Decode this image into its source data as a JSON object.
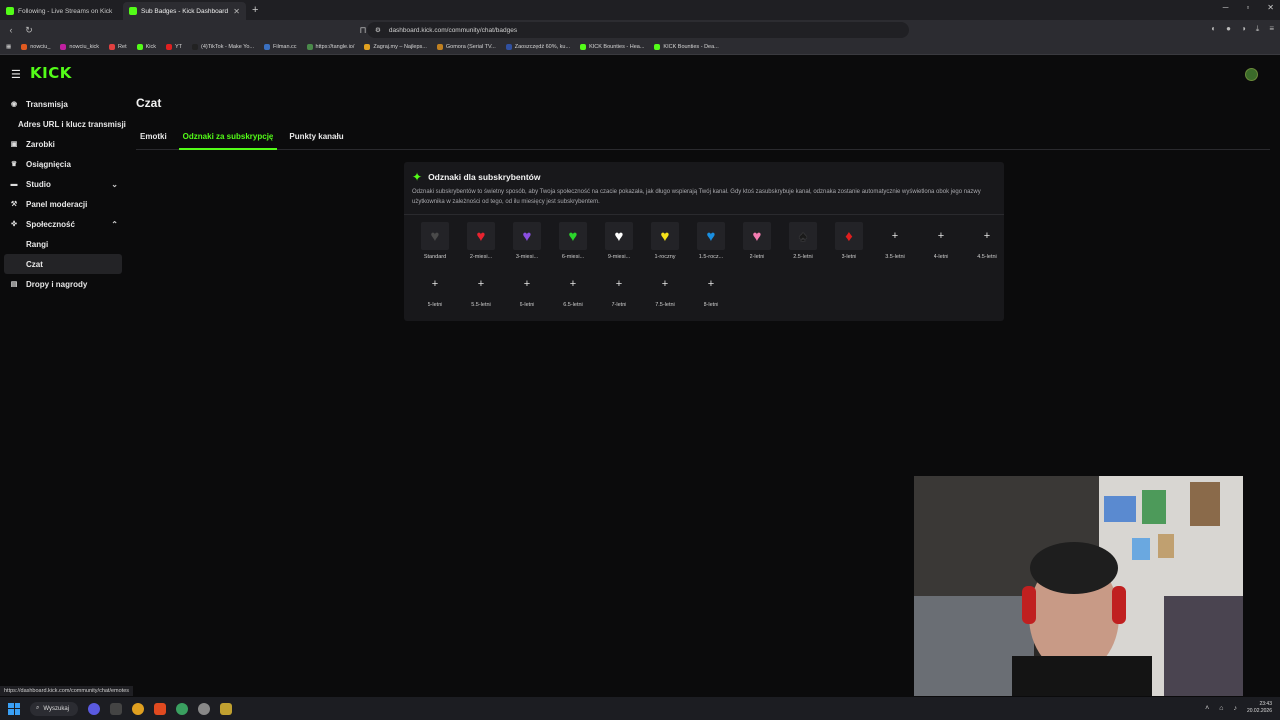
{
  "browser": {
    "tabs": [
      {
        "title": "Following - Live Streams on Kick",
        "active": false
      },
      {
        "title": "Sub Badges - Kick Dashboard",
        "active": true
      }
    ],
    "url": "dashboard.kick.com/community/chat/badges",
    "bookmarks": [
      "nowciu_",
      "nowciu_kick",
      "Ret",
      "Kick",
      "YT",
      "(4)TikTok - Make Yo...",
      "Filman.cc",
      "https://tangle.io/",
      "Zagraj.my – Najleps...",
      "Gomora (Serial TV...",
      "Zaoszczędź 60%, ku...",
      "KICK Bounties - Hea...",
      "KICK Bounties - Dea..."
    ]
  },
  "app": {
    "logo": "KICK",
    "sidebar": [
      {
        "label": "Transmisja",
        "icon": "broadcast-icon",
        "type": "main"
      },
      {
        "label": "Adres URL i klucz transmisji",
        "icon": "",
        "type": "indent"
      },
      {
        "label": "Zarobki",
        "icon": "money-icon",
        "type": "main"
      },
      {
        "label": "Osiągnięcia",
        "icon": "trophy-icon",
        "type": "main"
      },
      {
        "label": "Studio",
        "icon": "studio-icon",
        "type": "main",
        "chevron": "⌄"
      },
      {
        "label": "Panel moderacji",
        "icon": "wrench-icon",
        "type": "main"
      },
      {
        "label": "Społeczność",
        "icon": "community-icon",
        "type": "main",
        "chevron": "⌃"
      },
      {
        "label": "Rangi",
        "icon": "",
        "type": "sub"
      },
      {
        "label": "Czat",
        "icon": "",
        "type": "sub",
        "active": true
      },
      {
        "label": "Dropy i nagrody",
        "icon": "gift-icon",
        "type": "main"
      }
    ],
    "page_title": "Czat",
    "tabs": [
      {
        "label": "Emotki",
        "active": false
      },
      {
        "label": "Odznaki za subskrypcję",
        "active": true
      },
      {
        "label": "Punkty kanału",
        "active": false
      }
    ],
    "card": {
      "title": "Odznaki dla subskrybentów",
      "description": "Odznaki subskrybentów to świetny sposób, aby Twoja społeczność na czacie pokazała, jak długo wspierają Twój kanał. Gdy ktoś zasubskrybuje kanał, odznaka zostanie automatycznie wyświetlona obok jego nazwy użytkownika w zależności od tego, od ilu miesięcy jest subskrybentem.",
      "badges": [
        {
          "label": "Standard",
          "glyph": "♥",
          "color": "#4a4a4a"
        },
        {
          "label": "2-miesi...",
          "glyph": "♥",
          "color": "#e8232f"
        },
        {
          "label": "3-miesi...",
          "glyph": "♥",
          "color": "#8a4fe0"
        },
        {
          "label": "6-miesi...",
          "glyph": "♥",
          "color": "#2bd62b"
        },
        {
          "label": "9-miesi...",
          "glyph": "♥",
          "color": "#ffffff"
        },
        {
          "label": "1-roczny",
          "glyph": "♥",
          "color": "#f5e21a"
        },
        {
          "label": "1.5-rocz...",
          "glyph": "♥",
          "color": "#1a8fe0"
        },
        {
          "label": "2-letni",
          "glyph": "♥",
          "color": "#f37cb0"
        },
        {
          "label": "2.5-letni",
          "glyph": "♠",
          "color": "#1a1a1a"
        },
        {
          "label": "3-letni",
          "glyph": "♦",
          "color": "#e01e1e"
        },
        {
          "label": "3.5-letni",
          "glyph": "+",
          "color": ""
        },
        {
          "label": "4-letni",
          "glyph": "+",
          "color": ""
        },
        {
          "label": "4.5-letni",
          "glyph": "+",
          "color": ""
        },
        {
          "label": "5-letni",
          "glyph": "+",
          "color": ""
        },
        {
          "label": "5.5-letni",
          "glyph": "+",
          "color": ""
        },
        {
          "label": "6-letni",
          "glyph": "+",
          "color": ""
        },
        {
          "label": "6.5-letni",
          "glyph": "+",
          "color": ""
        },
        {
          "label": "7-letni",
          "glyph": "+",
          "color": ""
        },
        {
          "label": "7.5-letni",
          "glyph": "+",
          "color": ""
        },
        {
          "label": "8-letni",
          "glyph": "+",
          "color": ""
        }
      ]
    },
    "accent_color": "#53fc18"
  },
  "status_url": "https://dashboard.kick.com/community/chat/emotes",
  "taskbar": {
    "search_label": "Wyszukaj",
    "time": "23:43",
    "date": "20.02.2026"
  }
}
